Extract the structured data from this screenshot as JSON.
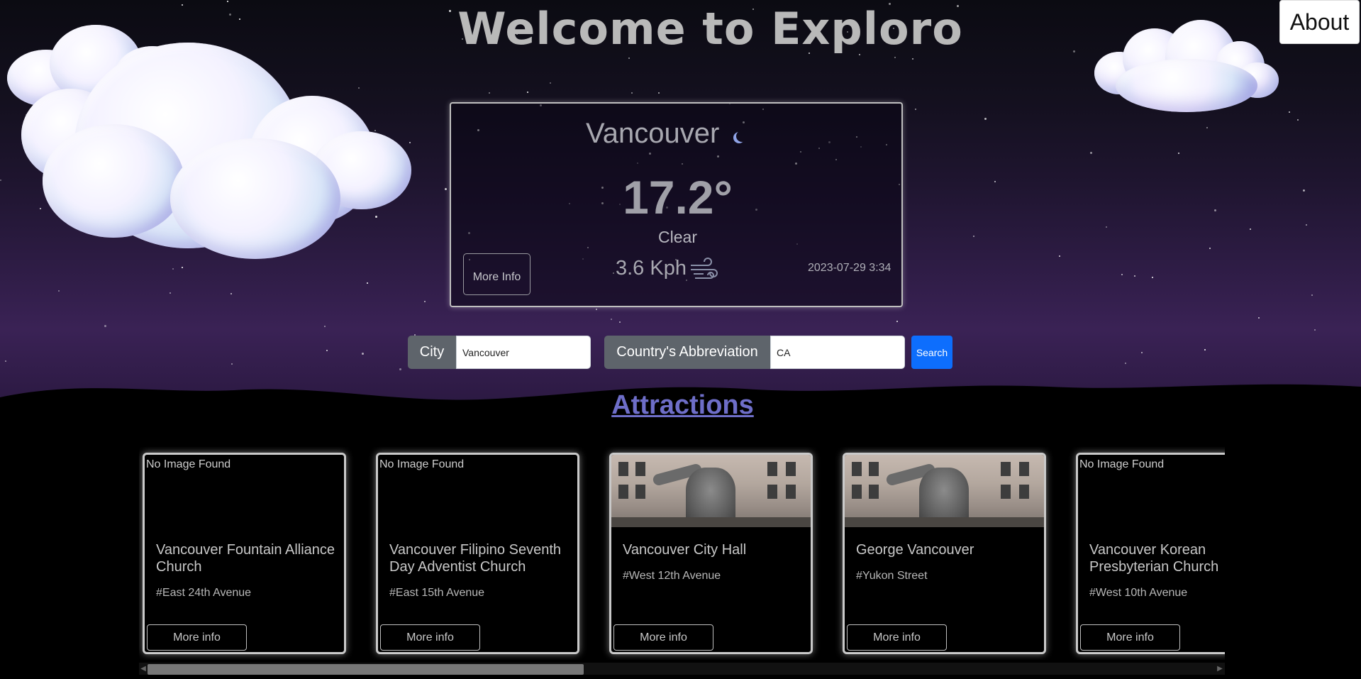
{
  "header": {
    "title": "Welcome to Exploro",
    "about_label": "About"
  },
  "weather": {
    "city": "Vancouver",
    "temperature": "17.2°",
    "condition": "Clear",
    "wind": "3.6 Kph",
    "datetime": "2023-07-29 3:34",
    "more_info_label": "More Info",
    "icon": "moon-icon"
  },
  "search": {
    "city_label": "City",
    "city_value": "Vancouver",
    "country_label": "Country's Abbreviation",
    "country_value": "CA",
    "search_label": "Search"
  },
  "attractions": {
    "title": "Attractions",
    "no_image_text": "No Image Found",
    "cards": [
      {
        "name": "Vancouver Fountain Alliance Church",
        "street": "#East 24th Avenue",
        "has_image": false,
        "button": "More info"
      },
      {
        "name": "Vancouver Filipino Seventh Day Adventist Church",
        "street": "#East 15th Avenue",
        "has_image": false,
        "button": "More info"
      },
      {
        "name": "Vancouver City Hall",
        "street": "#West 12th Avenue",
        "has_image": true,
        "button": "More info"
      },
      {
        "name": "George Vancouver",
        "street": "#Yukon Street",
        "has_image": true,
        "button": "More info"
      },
      {
        "name": "Vancouver Korean Presbyterian Church",
        "street": "#West 10th Avenue",
        "has_image": false,
        "button": "More info"
      }
    ]
  },
  "colors": {
    "search_button": "#0d6efd",
    "attractions_title": "#6e6ec8",
    "input_group_label": "#5e646b"
  }
}
